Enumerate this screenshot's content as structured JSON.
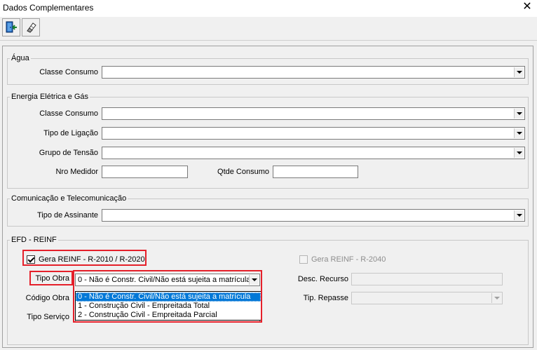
{
  "window": {
    "title": "Dados Complementares",
    "close_glyph": "✕"
  },
  "toolbar": {
    "buttons": [
      {
        "icon": "exit-door-icon"
      },
      {
        "icon": "eraser-icon"
      }
    ]
  },
  "agua": {
    "title": "Água",
    "classe_consumo": {
      "label": "Classe Consumo",
      "value": ""
    }
  },
  "energia": {
    "title": "Energia Elétrica e Gás",
    "classe_consumo": {
      "label": "Classe Consumo",
      "value": ""
    },
    "tipo_ligacao": {
      "label": "Tipo de Ligação",
      "value": ""
    },
    "grupo_tensao": {
      "label": "Grupo de Tensão",
      "value": ""
    },
    "nro_medidor": {
      "label": "Nro Medidor",
      "value": ""
    },
    "qtde_consumo": {
      "label": "Qtde Consumo",
      "value": ""
    }
  },
  "comunicacao": {
    "title": "Comunicação e Telecomunicação",
    "tipo_assinante": {
      "label": "Tipo de Assinante",
      "value": ""
    }
  },
  "efd": {
    "title": "EFD - REINF",
    "gera_reinf": {
      "label": "Gera REINF - R-2010 / R-2020",
      "checked": true
    },
    "gera_reinf_2040": {
      "label": "Gera REINF - R-2040",
      "checked": false,
      "enabled": false
    },
    "tipo_obra": {
      "label": "Tipo Obra",
      "value": "0 - Não é Constr. Civil/Não está sujeita a matrícula",
      "options": [
        "0 - Não é Constr. Civil/Não está sujeita a matrícula",
        "1 - Construção Civil - Empreitada Total",
        "2 - Construção Civil - Empreitada Parcial"
      ],
      "selected_index": 0
    },
    "codigo_obra": {
      "label": "Código Obra"
    },
    "tipo_servico": {
      "label": "Tipo Serviço"
    },
    "desc_recurso": {
      "label": "Desc. Recurso",
      "value": ""
    },
    "tip_repasse": {
      "label": "Tip. Repasse",
      "value": ""
    }
  },
  "colors": {
    "highlight": "#e5202a",
    "selection": "#0078d7"
  }
}
